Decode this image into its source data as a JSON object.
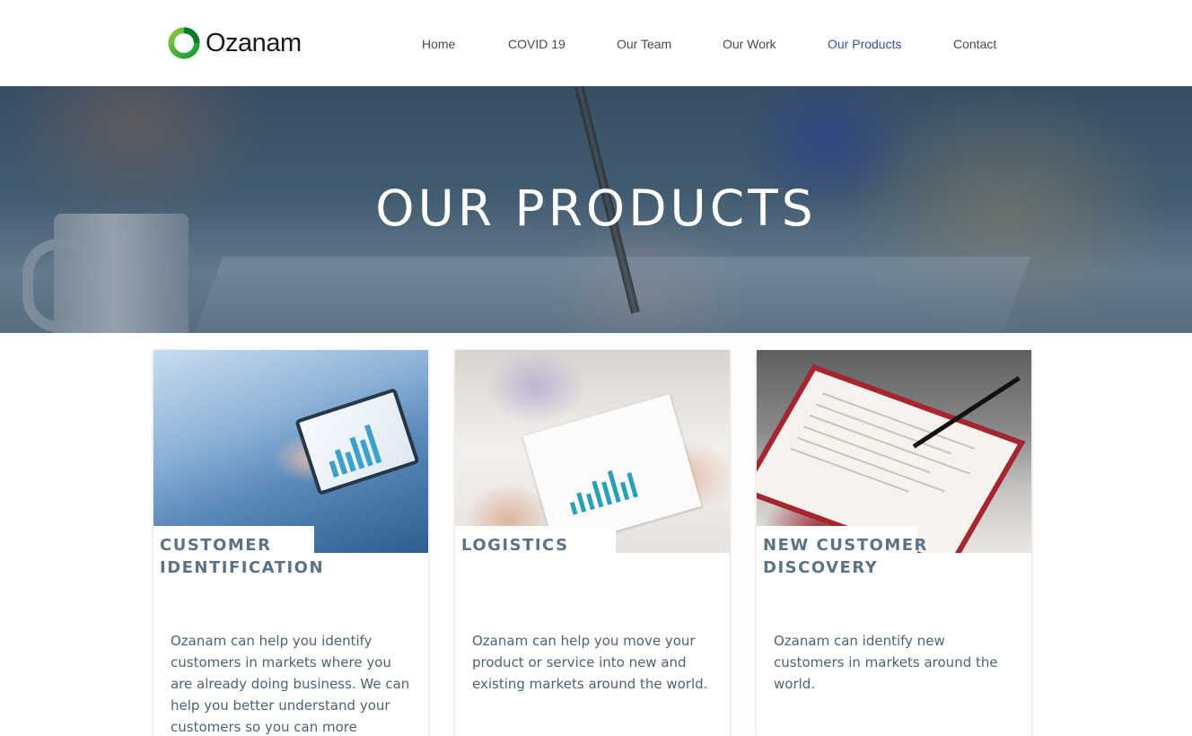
{
  "header": {
    "logo_text": "Ozanam",
    "nav": [
      {
        "label": "Home",
        "active": false
      },
      {
        "label": "COVID 19",
        "active": false
      },
      {
        "label": "Our Team",
        "active": false
      },
      {
        "label": "Our Work",
        "active": false
      },
      {
        "label": "Our Products",
        "active": true
      },
      {
        "label": "Contact",
        "active": false
      }
    ]
  },
  "hero": {
    "title": "OUR PRODUCTS"
  },
  "cards": [
    {
      "title_lines": [
        "CUSTOMER",
        "IDENTIFICATION"
      ],
      "text": "Ozanam can help you identify customers in markets where you are already doing business. We can help you better understand your customers so you can more"
    },
    {
      "title_lines": [
        "LOGISTICS"
      ],
      "text": "Ozanam can help you move your product or service into new and existing markets around the world."
    },
    {
      "title_lines": [
        "NEW CUSTOMER",
        "DISCOVERY"
      ],
      "text": "Ozanam can identify new customers in markets around the world."
    }
  ],
  "colors": {
    "nav_active": "#3a4fa0",
    "card_title": "#5c7386",
    "logo_green": "#2a9a3a"
  }
}
